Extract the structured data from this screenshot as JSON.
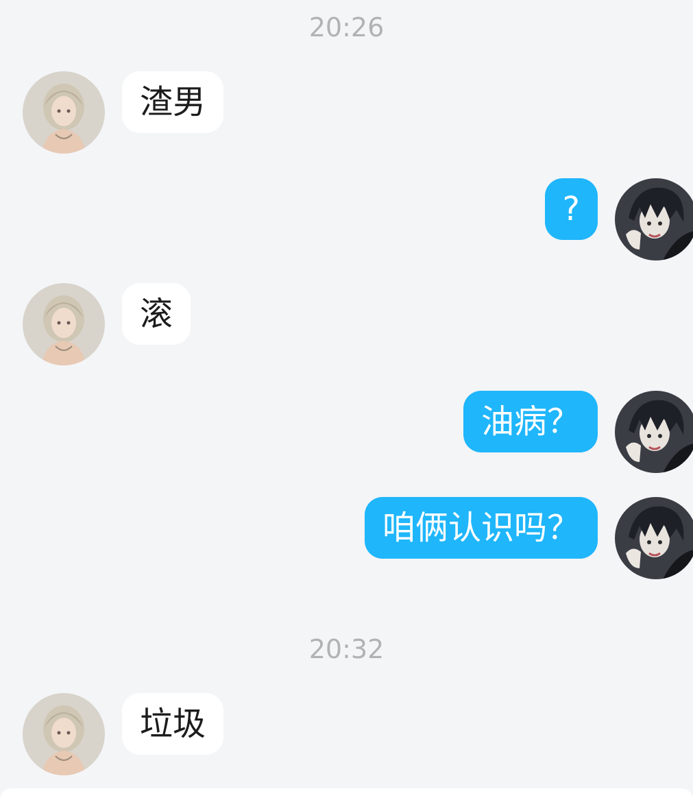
{
  "messages": [
    {
      "kind": "time",
      "text": "20:26"
    },
    {
      "kind": "msg",
      "side": "in",
      "text": "渣男",
      "avatar": "girl-avatar"
    },
    {
      "kind": "msg",
      "side": "out",
      "text": "?",
      "avatar": "boy-avatar"
    },
    {
      "kind": "msg",
      "side": "in",
      "text": "滚",
      "avatar": "girl-avatar"
    },
    {
      "kind": "msg",
      "side": "out",
      "text": "油病？",
      "avatar": "boy-avatar"
    },
    {
      "kind": "msg",
      "side": "out",
      "text": "咱俩认识吗？",
      "avatar": "boy-avatar"
    },
    {
      "kind": "time",
      "text": "20:32"
    },
    {
      "kind": "msg",
      "side": "in",
      "text": "垃圾",
      "avatar": "girl-avatar"
    }
  ],
  "colors": {
    "background": "#f4f5f7",
    "incoming_bubble": "#ffffff",
    "outgoing_bubble": "#1fb6fb",
    "timestamp_text": "#b2b2b2"
  }
}
